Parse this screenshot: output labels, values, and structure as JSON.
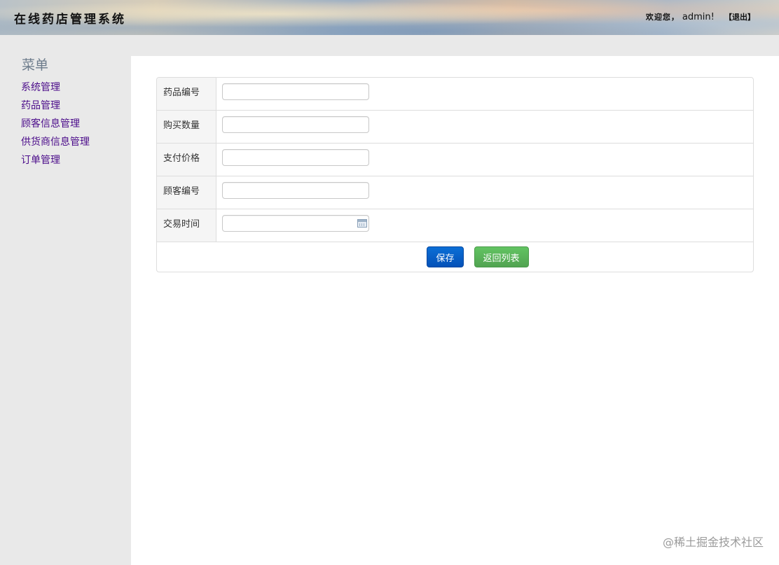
{
  "header": {
    "app_title": "在线药店管理系统",
    "welcome_text": "欢迎您，",
    "username": "admin!",
    "logout_label": "【退出】"
  },
  "sidebar": {
    "title": "菜单",
    "items": [
      {
        "label": "系统管理"
      },
      {
        "label": "药品管理"
      },
      {
        "label": "顾客信息管理"
      },
      {
        "label": "供货商信息管理"
      },
      {
        "label": "订单管理"
      }
    ]
  },
  "form": {
    "fields": [
      {
        "label": "药品编号",
        "value": "",
        "placeholder": ""
      },
      {
        "label": "购买数量",
        "value": "",
        "placeholder": ""
      },
      {
        "label": "支付价格",
        "value": "",
        "placeholder": ""
      },
      {
        "label": "顾客编号",
        "value": "",
        "placeholder": ""
      },
      {
        "label": "交易时间",
        "value": "",
        "placeholder": ""
      }
    ],
    "save_label": "保存",
    "back_label": "返回列表"
  },
  "watermark": "@稀土掘金技术社区",
  "colors": {
    "save_button": "#0451b8",
    "back_button": "#51a351",
    "menu_link": "#4b0c8a",
    "sidebar_bg": "#e9e9e9"
  }
}
